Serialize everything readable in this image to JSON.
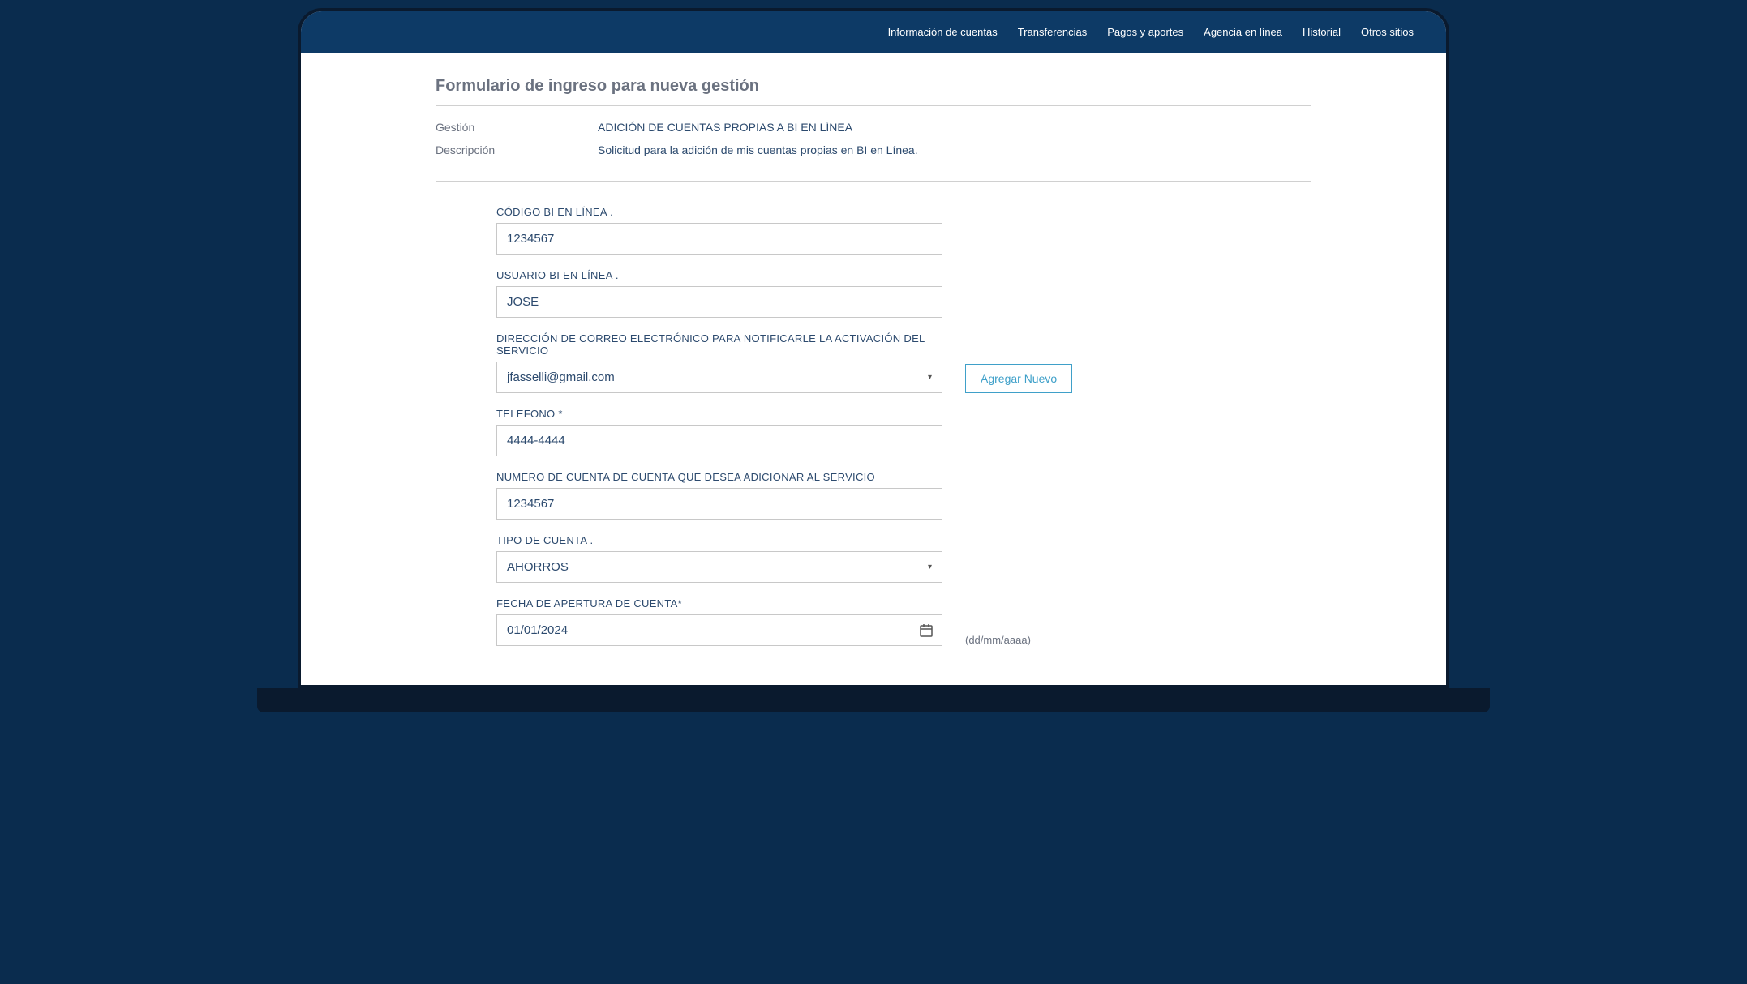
{
  "nav": {
    "items": [
      "Información de cuentas",
      "Transferencias",
      "Pagos y aportes",
      "Agencia en línea",
      "Historial",
      "Otros sitios"
    ]
  },
  "form": {
    "title": "Formulario de ingreso para nueva gestión",
    "gestion_label": "Gestión",
    "gestion_value": "ADICIÓN DE CUENTAS PROPIAS A BI EN LÍNEA",
    "descripcion_label": "Descripción",
    "descripcion_value": "Solicitud para la adición de mis cuentas propias en BI en Línea.",
    "fields": {
      "codigo": {
        "label": "CÓDIGO BI EN LÍNEA .",
        "value": "1234567"
      },
      "usuario": {
        "label": "USUARIO BI EN LÍNEA .",
        "value": "JOSE"
      },
      "email": {
        "label": "DIRECCIÓN DE CORREO ELECTRÓNICO PARA NOTIFICARLE LA ACTIVACIÓN DEL SERVICIO",
        "value": "jfasselli@gmail.com"
      },
      "telefono": {
        "label": "TELEFONO *",
        "value": "4444-4444"
      },
      "numero_cuenta": {
        "label": "NUMERO DE CUENTA DE CUENTA QUE DESEA ADICIONAR AL SERVICIO",
        "value": "1234567"
      },
      "tipo_cuenta": {
        "label": "TIPO DE CUENTA .",
        "value": "AHORROS"
      },
      "fecha": {
        "label": "FECHA DE APERTURA DE CUENTA*",
        "value": "01/01/2024",
        "hint": "(dd/mm/aaaa)"
      }
    },
    "buttons": {
      "agregar_nuevo": "Agregar Nuevo"
    }
  }
}
